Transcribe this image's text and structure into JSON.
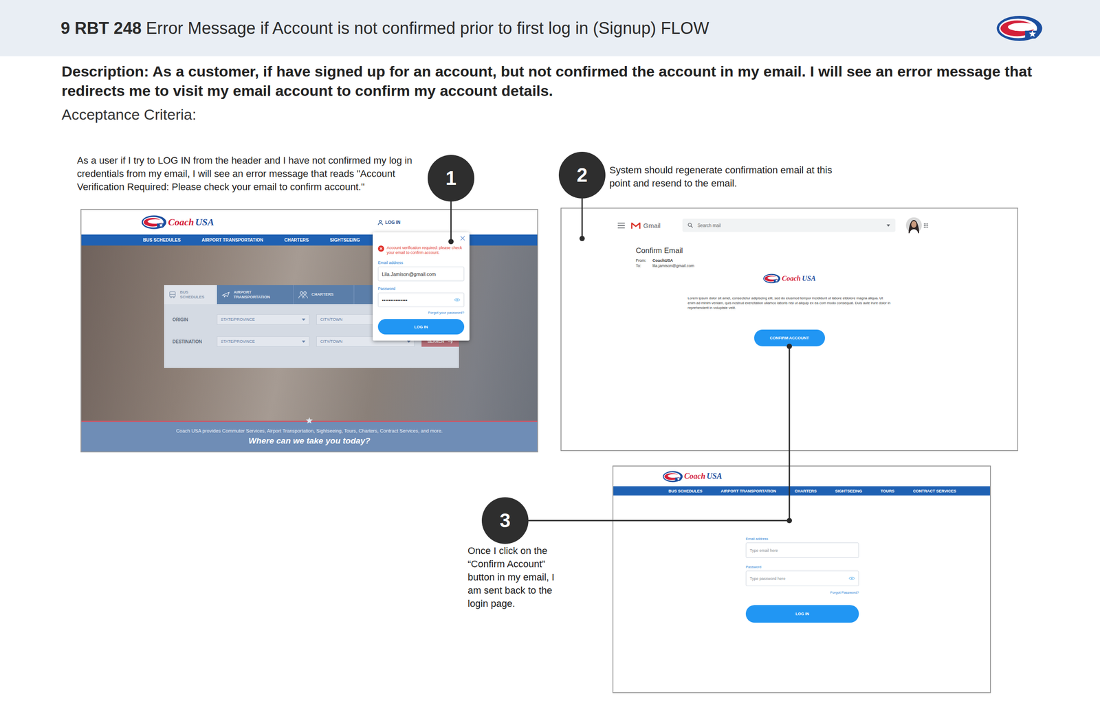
{
  "header": {
    "code": "9 RBT 248",
    "title": "Error Message if Account is not confirmed prior to first log in (Signup) FLOW"
  },
  "description": "Description: As a customer, if have signed up for an account, but not confirmed the account in my email. I will see an error message that redirects me to visit my email account to confirm my account details.",
  "acceptance_label": "Acceptance Criteria:",
  "steps": [
    {
      "number": "1",
      "text": "As a user if I try to LOG IN from the header and I have not confirmed my log in credentials from my email, I will see an error message that reads \"Account Verification Required: Please check your email to confirm account.\""
    },
    {
      "number": "2",
      "text": "System should regenerate confirmation email at this point and resend to the email."
    },
    {
      "number": "3",
      "text": "Once I click on the “Confirm Account” button in my email, I am sent back to the login page."
    }
  ],
  "brand": {
    "coach": "Coach",
    "usa": "USA"
  },
  "home_screen": {
    "login_link": "LOG IN",
    "nav": [
      "BUS SCHEDULES",
      "AIRPORT TRANSPORTATION",
      "CHARTERS",
      "SIGHTSEEING"
    ],
    "search_tabs": [
      {
        "label": "BUS SCHEDULES",
        "selected": true
      },
      {
        "label": "AIRPORT TRANSPORTATION",
        "selected": false
      },
      {
        "label": "CHARTERS",
        "selected": false
      }
    ],
    "search_rows": [
      {
        "label": "ORIGIN",
        "state": "STATE/PROVINCE",
        "city": "CITY/TOWN"
      },
      {
        "label": "DESTINATION",
        "state": "STATE/PROVINCE",
        "city": "CITY/TOWN"
      }
    ],
    "search_button": "SEARCH",
    "tagline": "Coach USA provides Commuter Services, Airport Transportation, Sightseeing, Tours, Charters, Contract Services, and more.",
    "headline": "Where can we take you today?",
    "login_popup": {
      "error": "Account verification required: please check your email to confirm account.",
      "email_label": "Email address",
      "email_value": "Lila.Jamison@gmail.com",
      "password_label": "Password",
      "password_value": "•••••••••••••••",
      "forgot": "Forgot your password?",
      "button": "LOG IN"
    }
  },
  "email_screen": {
    "app_name": "Gmail",
    "search_placeholder": "Search mail",
    "subject": "Confirm Email",
    "from_label": "From:",
    "from_value": "CoachUSA",
    "to_label": "To:",
    "to_value": "lila.jamison@gmail.com",
    "body": "Lorem ipsum dolor sit amet, consectetur adipiscing elit, sed do eiusmod tempor incididunt ut labore etdolore magna aliqua. Ut enim ad minim veniam, quis nostrud exercitation ullamco laboris nisi ut aliquip ex ea com modo consequat. Duis aute irure dolor in reprehenderit in voluptate velit.",
    "button": "CONFIRM ACCOUNT"
  },
  "login_screen": {
    "nav": [
      "BUS SCHEDULES",
      "AIRPORT TRANSPORTATION",
      "CHARTERS",
      "SIGHTSEEING",
      "TOURS",
      "CONTRACT SERVICES"
    ],
    "email_label": "Email address",
    "email_placeholder": "Type email here",
    "password_label": "Password",
    "password_placeholder": "Type password here",
    "forgot": "Forgot Password?",
    "button": "LOG IN"
  }
}
